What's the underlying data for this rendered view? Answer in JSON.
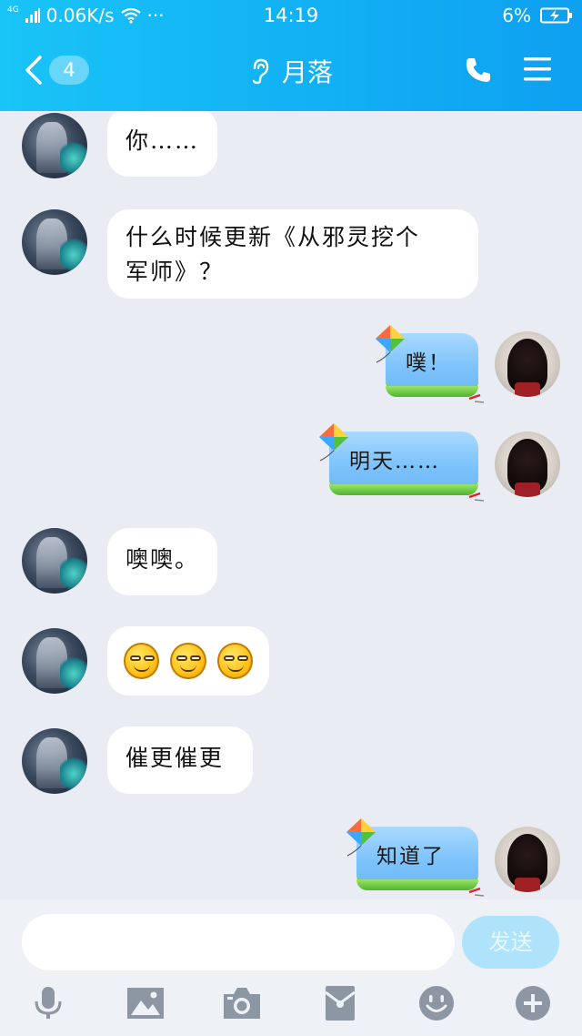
{
  "status_bar": {
    "network": "4G",
    "speed": "0.06K/s",
    "extra": "···",
    "time": "14:19",
    "battery": "6%"
  },
  "header": {
    "unread_count": "4",
    "title": "月落"
  },
  "messages": [
    {
      "side": "left",
      "text": "你……"
    },
    {
      "side": "left",
      "text_line1": "什么时候更新《从邪灵挖个",
      "text_line2": "军师》？"
    },
    {
      "side": "right",
      "text": "噗！"
    },
    {
      "side": "right",
      "text": "明天……"
    },
    {
      "side": "left",
      "text": "噢噢。"
    },
    {
      "side": "left",
      "emojis": [
        "smirk-emoji",
        "smirk-emoji",
        "smirk-emoji"
      ]
    },
    {
      "side": "left",
      "text": "催更催更"
    },
    {
      "side": "right",
      "text": "知道了"
    }
  ],
  "input": {
    "placeholder": "",
    "send_label": "发送"
  },
  "toolbar": [
    "microphone-icon",
    "image-icon",
    "camera-icon",
    "red-packet-icon",
    "emoji-icon",
    "plus-icon"
  ],
  "colors": {
    "header_start": "#19c4f7",
    "header_end": "#0ea0f1",
    "chat_bg": "#e9edf3",
    "send_button": "#aee3fb",
    "toolbar_icon": "#8d96a3"
  }
}
